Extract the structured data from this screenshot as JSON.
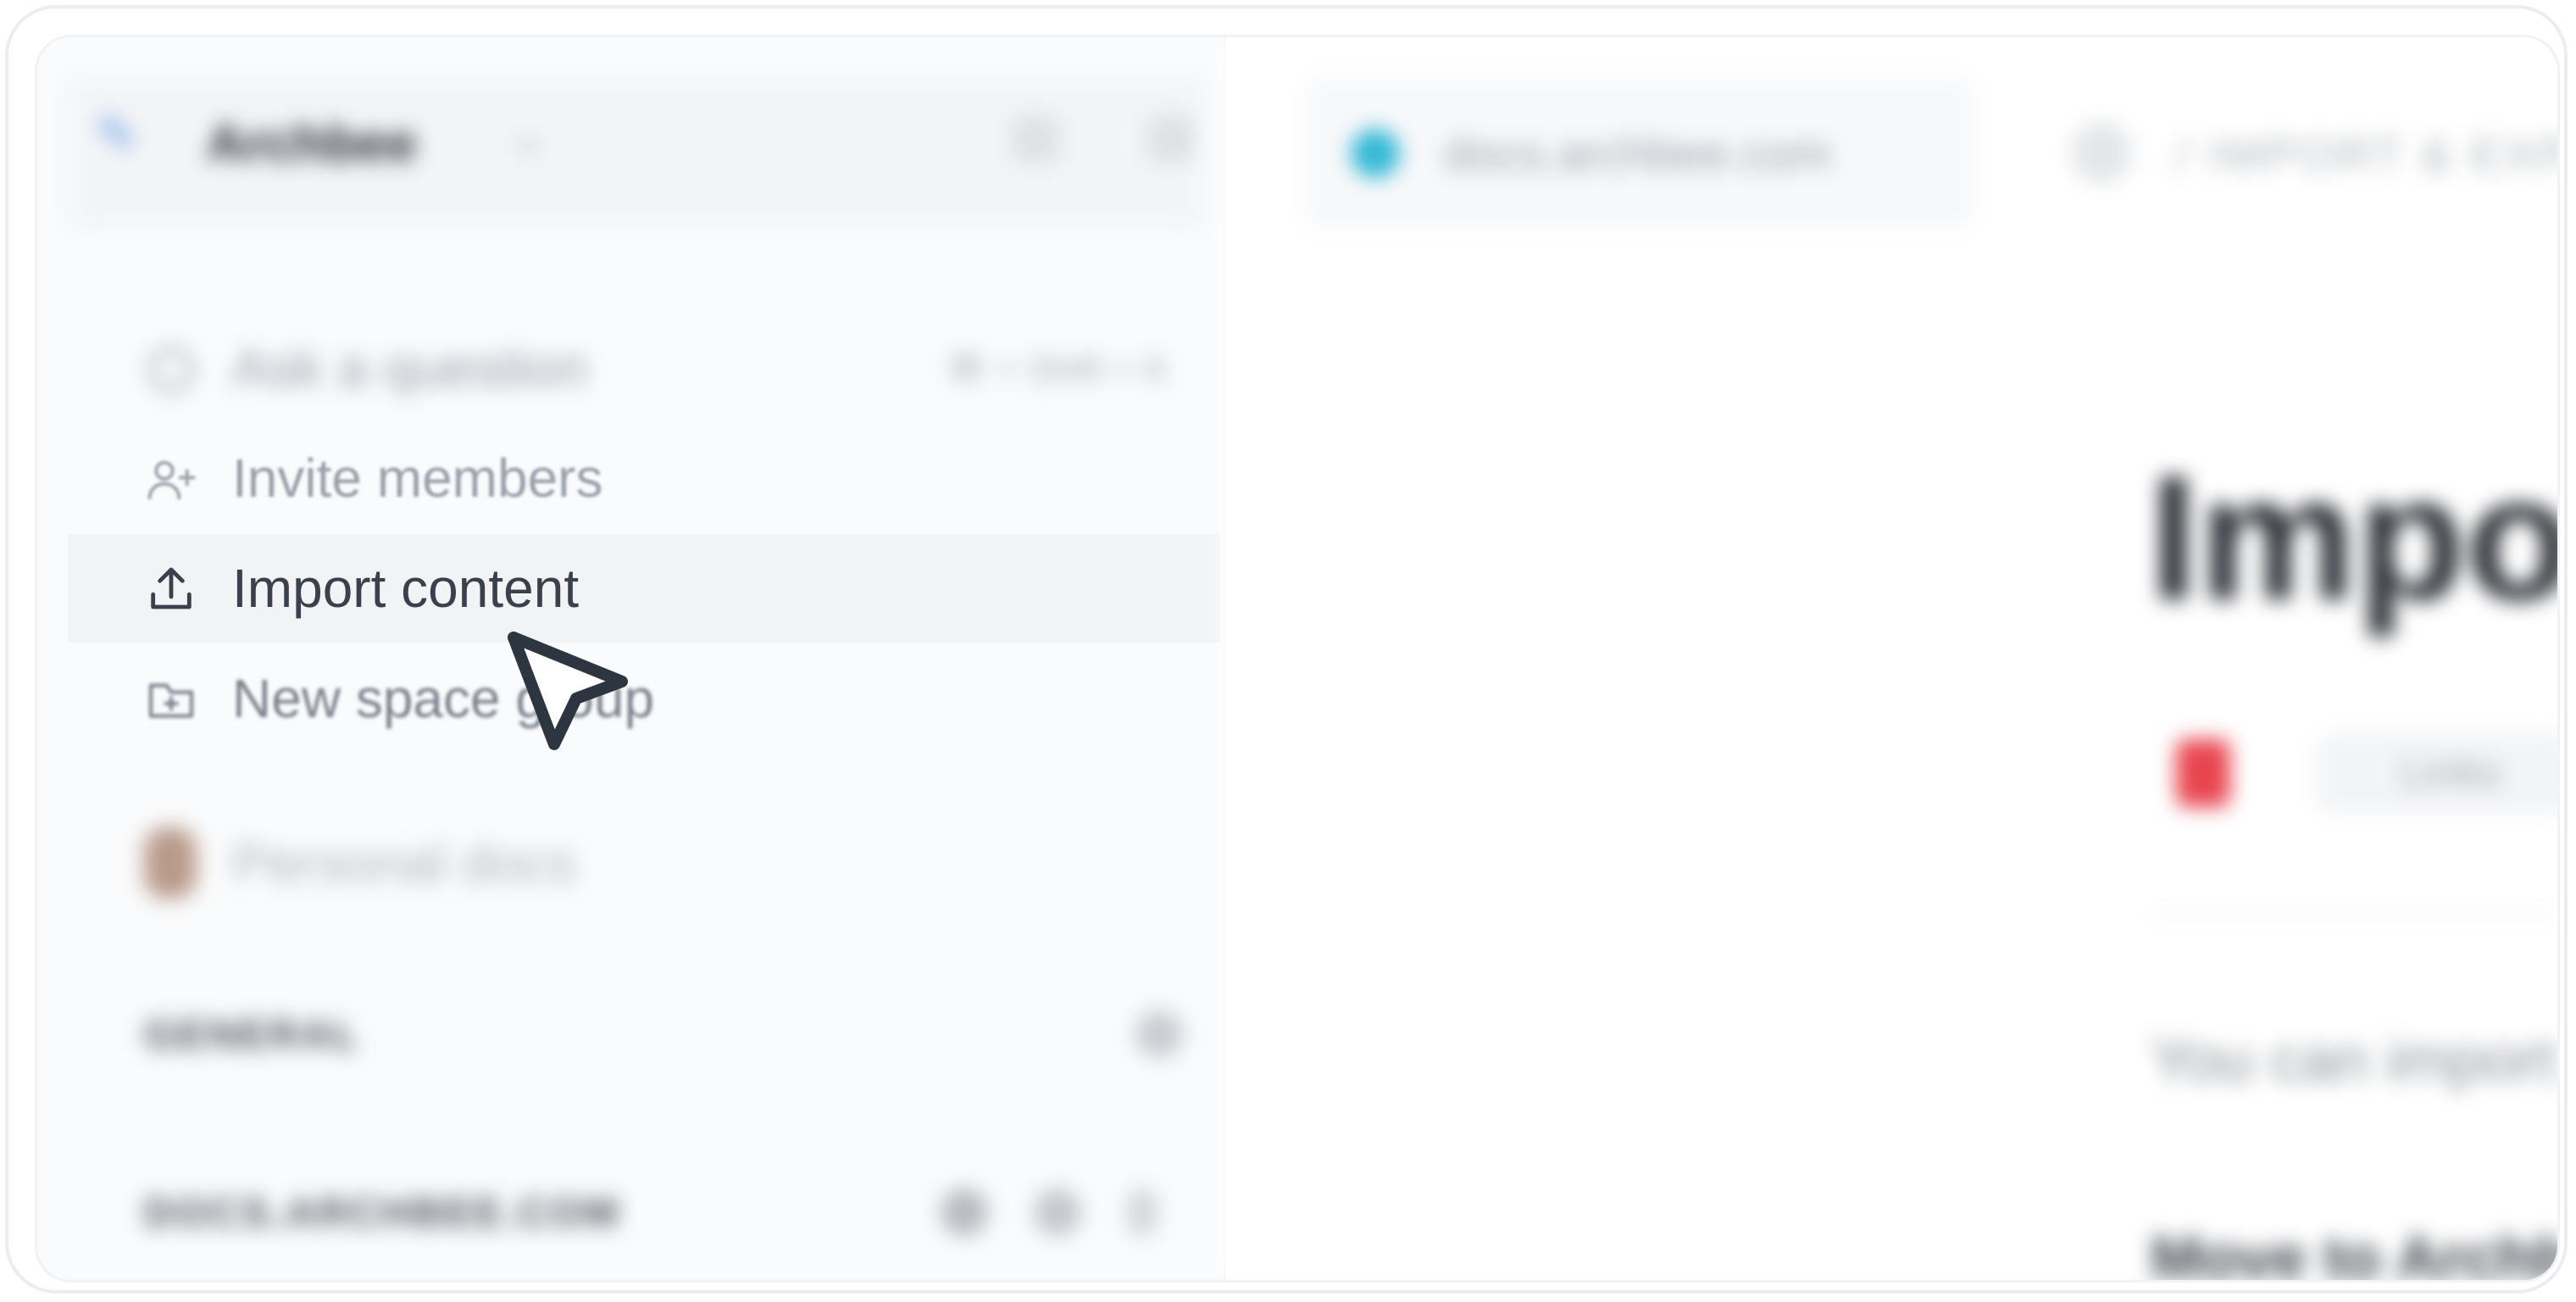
{
  "sidebar": {
    "org_name": "Archbee",
    "menu": {
      "ask": {
        "label": "Ask a question",
        "shortcut": "⌘ + Shift + K"
      },
      "invite": {
        "label": "Invite members"
      },
      "import": {
        "label": "Import content"
      },
      "new_group": {
        "label": "New space group"
      }
    },
    "user_space": {
      "label": "Personal docs"
    },
    "section_general": {
      "label": "GENERAL"
    },
    "section_docs": {
      "label": "DOCS.ARCHBEE.COM"
    }
  },
  "main": {
    "url": "docs.archbee.com",
    "breadcrumb": "/ IMPORT & EXPORT",
    "title": "Import content",
    "link_label": "Links",
    "description": "You can import content from",
    "subheading": "Move to Archbee"
  },
  "colors": {
    "accent": "#35b8d6",
    "danger": "#e8454f",
    "cursor": "#2d3540"
  },
  "icons": {
    "logo": "archbee-logo-icon",
    "ask": "question-icon",
    "invite": "add-user-icon",
    "import": "upload-icon",
    "new_group": "folder-plus-icon",
    "cursor": "mouse-pointer-icon"
  }
}
